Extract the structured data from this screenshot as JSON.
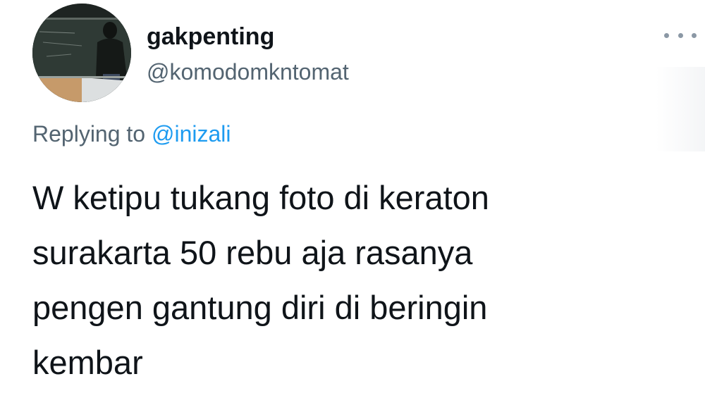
{
  "author": {
    "display_name": "gakpenting",
    "handle": "@komodomkntomat"
  },
  "reply": {
    "prefix": "Replying to",
    "mention": "@inizali"
  },
  "tweet": {
    "lines": [
      "W ketipu tukang foto di keraton",
      "surakarta 50 rebu aja rasanya",
      "pengen gantung diri di beringin",
      "kembar"
    ]
  },
  "icons": {
    "more": "more-horizontal-icon",
    "avatar": "avatar-photo"
  },
  "colors": {
    "text_primary": "#0f1419",
    "text_secondary": "#536471",
    "accent": "#1d9bf0"
  }
}
